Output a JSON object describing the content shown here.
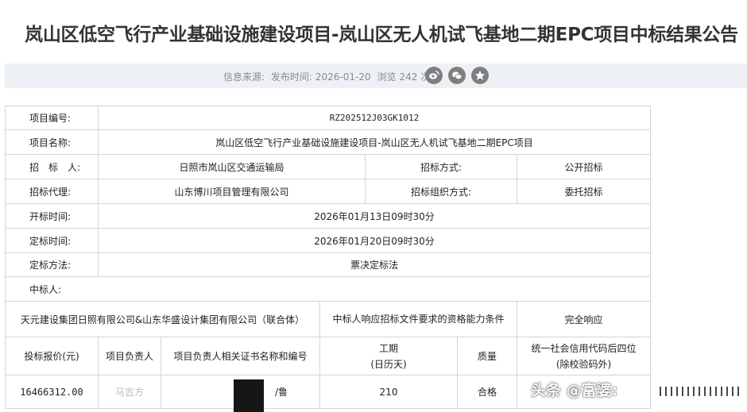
{
  "page_title": "岚山区低空飞行产业基础设施建设项目-岚山区无人机试飞基地二期EPC项目中标结果公告",
  "meta": {
    "source_label": "信息来源:",
    "publish_label": "发布时间:",
    "publish_date": "2026-01-20",
    "views_label": "浏览",
    "views": "242",
    "views_unit": "次",
    "share_icons": [
      "weibo-icon",
      "wechat-icon",
      "favorite-icon"
    ]
  },
  "table": {
    "project_no_label": "项目编号:",
    "project_no": "RZ202512J03GK1012",
    "project_name_label": "项目名称:",
    "project_name": "岚山区低空飞行产业基础设施建设项目-岚山区无人机试飞基地二期EPC项目",
    "tenderer_label": "招　标　人:",
    "tenderer": "日照市岚山区交通运输局",
    "tender_method_label": "招标方式:",
    "tender_method": "公开招标",
    "agent_label": "招标代理:",
    "agent": "山东博川项目管理有限公司",
    "org_method_label": "招标组织方式:",
    "org_method": "委托招标",
    "open_time_label": "开标时间:",
    "open_time": "2026年01月13日09时30分",
    "award_time_label": "定标时间:",
    "award_time": "2026年01月20日09时30分",
    "award_method_label": "定标方法:",
    "award_method": "票决定标法",
    "winner_label": "中标人:",
    "winner_name": "天元建设集团日照有限公司&山东华盛设计集团有限公司（联合体）",
    "qual_label": "中标人响应招标文件要求的资格能力条件",
    "qual_value": "完全响应",
    "bid_price_header": "投标报价(元)",
    "pm_header": "项目负责人",
    "cert_header": "项目负责人相关证书名称和编号",
    "duration_header_1": "工期",
    "duration_header_2": "(日历天)",
    "quality_header": "质量",
    "credit_header_1": "统一社会信用代码后四位",
    "credit_header_2": "(除校验码外)",
    "bid_price": "16466312.00",
    "pm_name": "马吉方",
    "cert_partial": "/鲁",
    "duration": "210",
    "quality": "合格"
  },
  "watermark": "头条 @富婆:"
}
